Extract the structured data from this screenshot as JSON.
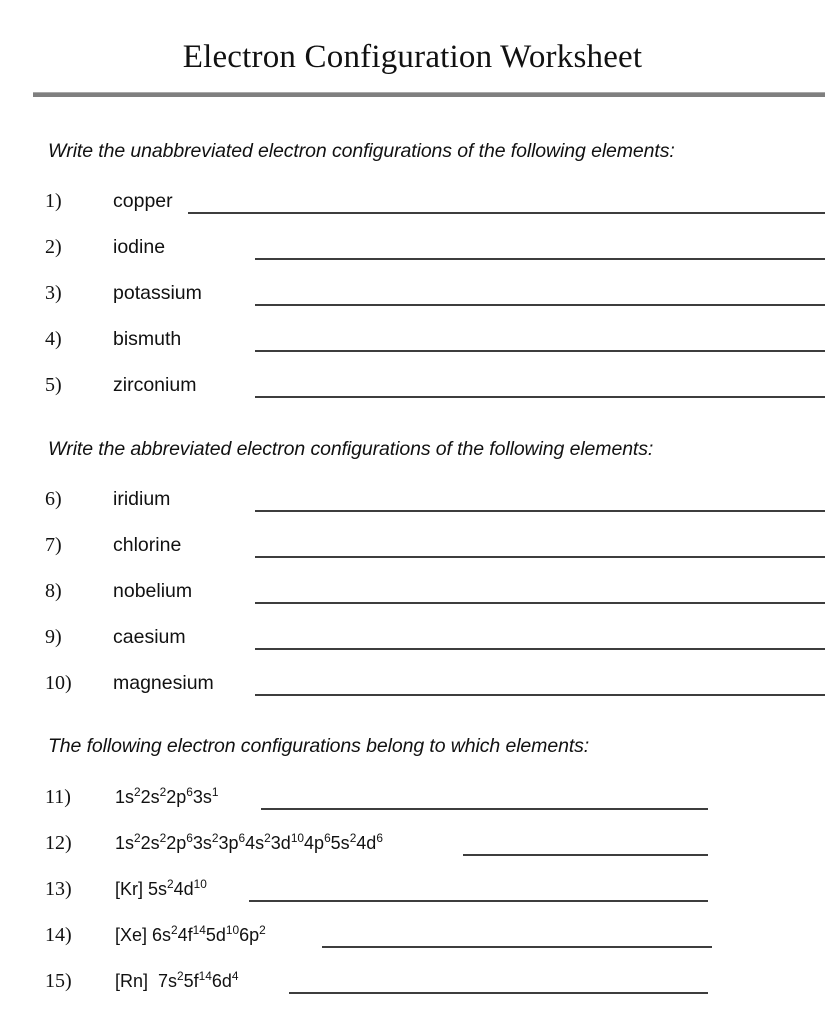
{
  "document": {
    "title": "Electron Configuration Worksheet"
  },
  "divider": {
    "color": "#7f7f7f"
  },
  "sections": [
    {
      "id": "unabbreviated",
      "heading": "Write the unabbreviated electron configurations of the following elements:",
      "items": [
        {
          "number": "1)",
          "label": "copper"
        },
        {
          "number": "2)",
          "label": "iodine"
        },
        {
          "number": "3)",
          "label": "potassium"
        },
        {
          "number": "4)",
          "label": "bismuth"
        },
        {
          "number": "5)",
          "label": "zirconium"
        }
      ]
    },
    {
      "id": "abbreviated",
      "heading": "Write the abbreviated electron configurations of the following elements:",
      "items": [
        {
          "number": "6)",
          "label": "iridium"
        },
        {
          "number": "7)",
          "label": "chlorine"
        },
        {
          "number": "8)",
          "label": "nobelium"
        },
        {
          "number": "9)",
          "label": "caesium"
        },
        {
          "number": "10)",
          "label": "magnesium"
        }
      ]
    },
    {
      "id": "identify-element",
      "heading": "The following electron configurations belong to which elements:",
      "items": [
        {
          "number": "11)",
          "configuration": "1s22s22p63s1",
          "configuration_plain": "1s2 2s2 2p6 3s1",
          "parts": [
            {
              "base": "1s",
              "sup": "2"
            },
            {
              "base": "2s",
              "sup": "2"
            },
            {
              "base": "2p",
              "sup": "6"
            },
            {
              "base": "3s",
              "sup": "1"
            }
          ]
        },
        {
          "number": "12)",
          "configuration": "1s22s22p63s23p64s23d104p65s24d6",
          "configuration_plain": "1s2 2s2 2p6 3s2 3p6 4s2 3d10 4p6 5s2 4d6",
          "parts": [
            {
              "base": "1s",
              "sup": "2"
            },
            {
              "base": "2s",
              "sup": "2"
            },
            {
              "base": "2p",
              "sup": "6"
            },
            {
              "base": "3s",
              "sup": "2"
            },
            {
              "base": "3p",
              "sup": "6"
            },
            {
              "base": "4s",
              "sup": "2"
            },
            {
              "base": "3d",
              "sup": "10"
            },
            {
              "base": "4p",
              "sup": "6"
            },
            {
              "base": "5s",
              "sup": "2"
            },
            {
              "base": "4d",
              "sup": "6"
            }
          ]
        },
        {
          "number": "13)",
          "configuration": "[Kr] 5s24d10",
          "configuration_plain": "[Kr] 5s2 4d10",
          "parts": [
            {
              "base": "[Kr] 5s",
              "sup": "2"
            },
            {
              "base": "4d",
              "sup": "10"
            }
          ]
        },
        {
          "number": "14)",
          "configuration": "[Xe] 6s24f145d106p2",
          "configuration_plain": "[Xe] 6s2 4f14 5d10 6p2",
          "parts": [
            {
              "base": "[Xe] 6s",
              "sup": "2"
            },
            {
              "base": "4f",
              "sup": "14"
            },
            {
              "base": "5d",
              "sup": "10"
            },
            {
              "base": "6p",
              "sup": "2"
            }
          ]
        },
        {
          "number": "15)",
          "configuration": "[Rn]  7s25f146d4",
          "configuration_plain": "[Rn]  7s2 5f14 6d4",
          "parts": [
            {
              "base": "[Rn]  7s",
              "sup": "2"
            },
            {
              "base": "5f",
              "sup": "14"
            },
            {
              "base": "6d",
              "sup": "4"
            }
          ]
        }
      ]
    }
  ]
}
